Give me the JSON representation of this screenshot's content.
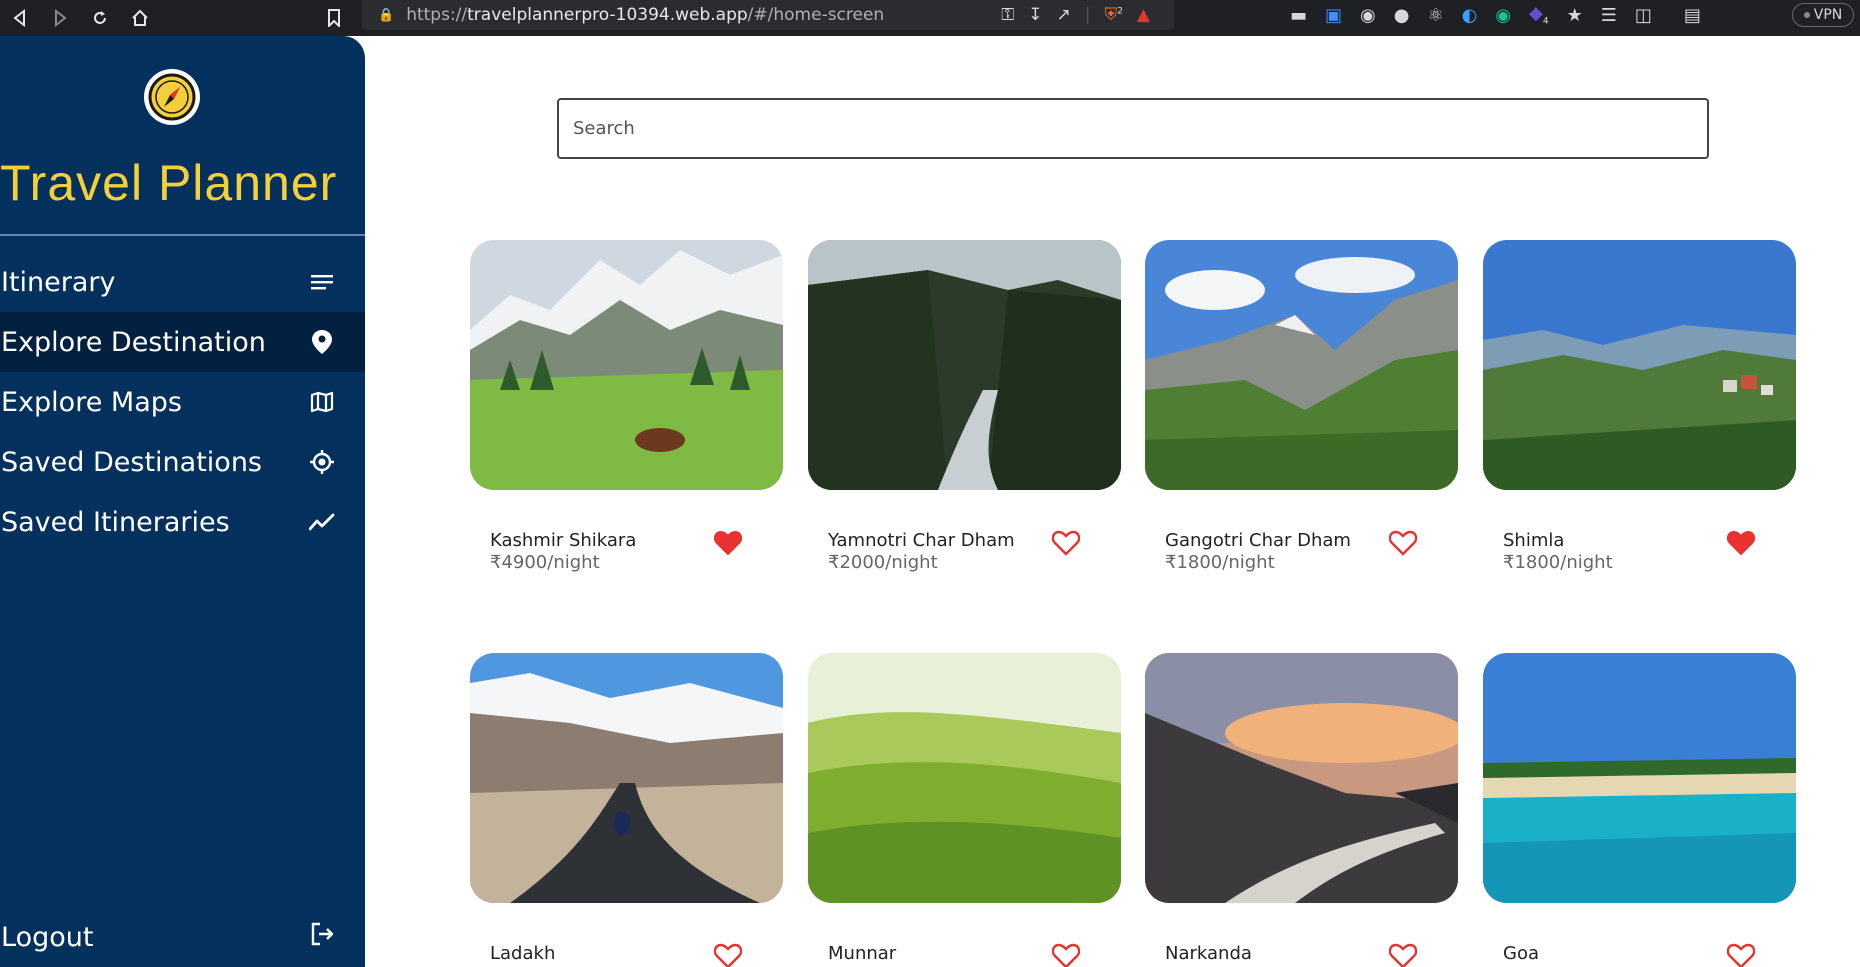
{
  "browser": {
    "url_scheme": "https://",
    "url_host": "travelplannerpro-10394.web.app",
    "url_path": "/#/home-screen",
    "brave_badge": "2",
    "ext_badge": "4",
    "vpn_label": "VPN"
  },
  "sidebar": {
    "title": "Travel Planner",
    "items": [
      {
        "label": "Itinerary",
        "icon": "list-icon"
      },
      {
        "label": "Explore Destination",
        "icon": "location-pin-icon"
      },
      {
        "label": "Explore Maps",
        "icon": "map-icon"
      },
      {
        "label": "Saved Destinations",
        "icon": "target-icon"
      },
      {
        "label": "Saved Itineraries",
        "icon": "trend-line-icon"
      }
    ],
    "active_item": "Explore Destination",
    "logout_label": "Logout"
  },
  "search": {
    "placeholder": "Search"
  },
  "destinations": [
    {
      "name": "Kashmir Shikara",
      "price": "₹4900/night",
      "favorited": true
    },
    {
      "name": "Yamnotri Char Dham",
      "price": "₹2000/night",
      "favorited": false
    },
    {
      "name": "Gangotri Char Dham",
      "price": "₹1800/night",
      "favorited": false
    },
    {
      "name": "Shimla",
      "price": "₹1800/night",
      "favorited": true
    },
    {
      "name": "Ladakh",
      "price": "",
      "favorited": false
    },
    {
      "name": "Munnar",
      "price": "",
      "favorited": false
    },
    {
      "name": "Narkanda",
      "price": "",
      "favorited": false
    },
    {
      "name": "Goa",
      "price": "",
      "favorited": false
    }
  ],
  "colors": {
    "sidebar_bg": "#04305e",
    "sidebar_active": "#02203f",
    "title_yellow": "#f5cf3a",
    "heart_red": "#e8322f"
  }
}
